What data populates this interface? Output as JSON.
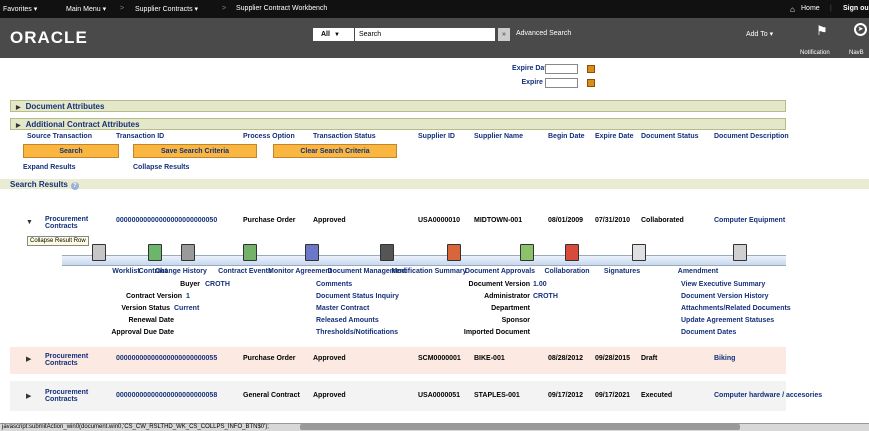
{
  "nav": {
    "favorites": "Favorites ▾",
    "main_menu": "Main Menu ▾",
    "sep1": ">",
    "supplier_contracts": "Supplier Contracts ▾",
    "sep2": ">",
    "workbench": "Supplier Contract Workbench",
    "home": "Home",
    "sign_out": "Sign ou"
  },
  "header": {
    "logo": "ORACLE",
    "scope": "All",
    "search_placeholder": "Search",
    "advanced_search": "Advanced Search",
    "add_to": "Add To ▾",
    "notification": "Notification",
    "navbar": "NavB"
  },
  "filters": {
    "expire_from": "Expire Date From",
    "expire_to": "Expire Date To"
  },
  "sections": {
    "doc_attrs": "Document Attributes",
    "add_attrs": "Additional Contract Attributes"
  },
  "buttons": {
    "search": "Search",
    "save_criteria": "Save Search Criteria",
    "clear_criteria": "Clear Search Criteria",
    "expand": "Expand Results",
    "collapse": "Collapse Results"
  },
  "results": {
    "title": "Search Results",
    "columns": [
      "Source Transaction",
      "Transaction ID",
      "Process Option",
      "Transaction Status",
      "Supplier ID",
      "Supplier Name",
      "Begin Date",
      "Expire Date",
      "Document Status",
      "Document Description"
    ],
    "rows": [
      [
        "Procurement Contracts",
        "00000000000000000000000050",
        "Purchase Order",
        "Approved",
        "USA0000010",
        "MIDTOWN-001",
        "08/01/2009",
        "07/31/2010",
        "Collaborated",
        "Computer Equipment"
      ],
      [
        "Procurement Contracts",
        "00000000000000000000000055",
        "Purchase Order",
        "Approved",
        "SCM0000001",
        "BIKE-001",
        "08/28/2012",
        "09/28/2015",
        "Draft",
        "Biking"
      ],
      [
        "Procurement Contracts",
        "00000000000000000000000058",
        "General Contract",
        "Approved",
        "USA0000051",
        "STAPLES-001",
        "09/17/2012",
        "09/17/2021",
        "Executed",
        "Computer hardware / accesories"
      ]
    ],
    "tooltip": "Collapse Result Row"
  },
  "icons": [
    {
      "label": "Worklist",
      "color": "#c6c6c6"
    },
    {
      "label": "Contract",
      "color": "#6bb66b"
    },
    {
      "label": "Change History",
      "color": "#9a9a9a"
    },
    {
      "label": "Contract Events",
      "color": "#74b26a"
    },
    {
      "label": "Monitor Agreement",
      "color": "#6b77c9"
    },
    {
      "label": "Document Management",
      "color": "#555555"
    },
    {
      "label": "Modification Summary",
      "color": "#d9663a"
    },
    {
      "label": "Document Approvals",
      "color": "#8cc36a"
    },
    {
      "label": "Collaboration",
      "color": "#d84a3a"
    },
    {
      "label": "Signatures",
      "color": "#e0e0e0"
    },
    {
      "label": "Amendment",
      "color": "#d0d0d0"
    }
  ],
  "details": {
    "buyer_label": "Buyer",
    "buyer": "CROTH",
    "version_label": "Contract Version",
    "version": "1",
    "vstatus_label": "Version Status",
    "vstatus": "Current",
    "renewal": "Renewal Date",
    "approval_due": "Approval Due Date",
    "mid": [
      "Comments",
      "Document Status Inquiry",
      "Master Contract",
      "Released Amounts",
      "Thresholds/Notifications"
    ],
    "docver_label": "Document Version",
    "docver": "1.00",
    "admin_label": "Administrator",
    "admin": "CROTH",
    "dept": "Department",
    "sponsor": "Sponsor",
    "imported": "Imported Document",
    "right": [
      "View Executive Summary",
      "Document Version History",
      "Attachments/Related Documents",
      "Update Agreement Statuses",
      "Document Dates"
    ]
  },
  "status": "javascript:submitAction_win0(document.win0,'CS_CW_RSLTHD_WK_CS_COLLPS_INFO_BTN$0');"
}
